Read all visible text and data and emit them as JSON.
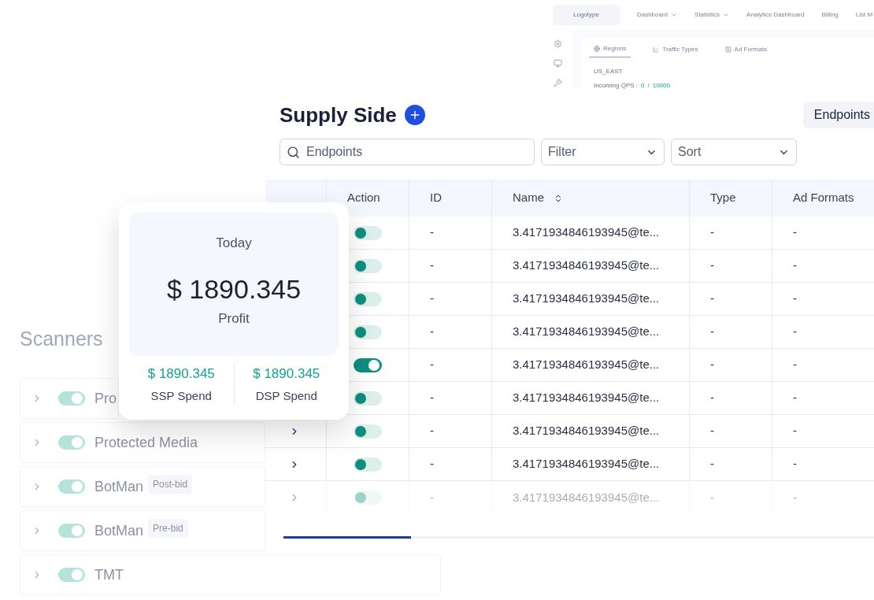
{
  "dashboard_preview": {
    "logo": "Logotype",
    "nav": [
      {
        "label": "Dashboard",
        "dropdown": true
      },
      {
        "label": "Statistics",
        "dropdown": true
      },
      {
        "label": "Analytics Dashboard",
        "dropdown": false
      },
      {
        "label": "Billing",
        "dropdown": false
      },
      {
        "label": "List M",
        "dropdown": false
      }
    ],
    "tabs": [
      {
        "label": "Regions",
        "selected": true
      },
      {
        "label": "Traffic Types",
        "selected": false
      },
      {
        "label": "Ad Formats",
        "selected": false
      }
    ],
    "region": "US_EAST",
    "qps_label": "Incoming QPS :",
    "qps_current": "0",
    "qps_separator": "/",
    "qps_max": "10000"
  },
  "scanners": {
    "title": "Scanners",
    "items": [
      {
        "name": "Pro",
        "on": true
      },
      {
        "name": "Protected Media",
        "on": true
      },
      {
        "name": "BotMan",
        "tag": "Post-bid",
        "on": true
      },
      {
        "name": "BotMan",
        "tag": "Pre-bid",
        "on": true
      },
      {
        "name": "TMT",
        "on": true
      }
    ]
  },
  "supply_side": {
    "title": "Supply Side",
    "endpoints_button": "Endpoints",
    "search": {
      "placeholder": "Endpoints"
    },
    "filter": "Filter",
    "sort": "Sort",
    "table": {
      "columns": [
        {
          "label": "Action",
          "sortable": false
        },
        {
          "label": "ID",
          "sortable": false
        },
        {
          "label": "Name",
          "sortable": true
        },
        {
          "label": "Type",
          "sortable": false
        },
        {
          "label": "Ad Formats",
          "sortable": false
        }
      ],
      "rows": [
        {
          "on": false,
          "id": "-",
          "name": "3.4171934846193945@te...",
          "type": "-",
          "ad_formats": "-"
        },
        {
          "on": false,
          "id": "-",
          "name": "3.4171934846193945@te...",
          "type": "-",
          "ad_formats": "-"
        },
        {
          "on": false,
          "id": "-",
          "name": "3.4171934846193945@te...",
          "type": "-",
          "ad_formats": "-"
        },
        {
          "on": false,
          "id": "-",
          "name": "3.4171934846193945@te...",
          "type": "-",
          "ad_formats": "-"
        },
        {
          "on": true,
          "id": "-",
          "name": "3.4171934846193945@te...",
          "type": "-",
          "ad_formats": "-"
        },
        {
          "on": false,
          "id": "-",
          "name": "3.4171934846193945@te...",
          "type": "-",
          "ad_formats": "-"
        },
        {
          "on": false,
          "id": "-",
          "name": "3.4171934846193945@te...",
          "type": "-",
          "ad_formats": "-"
        },
        {
          "on": false,
          "id": "-",
          "name": "3.4171934846193945@te...",
          "type": "-",
          "ad_formats": "-"
        },
        {
          "on": false,
          "id": "-",
          "name": "3.4171934846193945@te...",
          "type": "-",
          "ad_formats": "-"
        }
      ]
    }
  },
  "stats_card": {
    "period": "Today",
    "profit": "$ 1890.345",
    "profit_label": "Profit",
    "spends": [
      {
        "value": "$ 1890.345",
        "label": "SSP Spend"
      },
      {
        "value": "$ 1890.345",
        "label": "DSP Spend"
      }
    ]
  }
}
